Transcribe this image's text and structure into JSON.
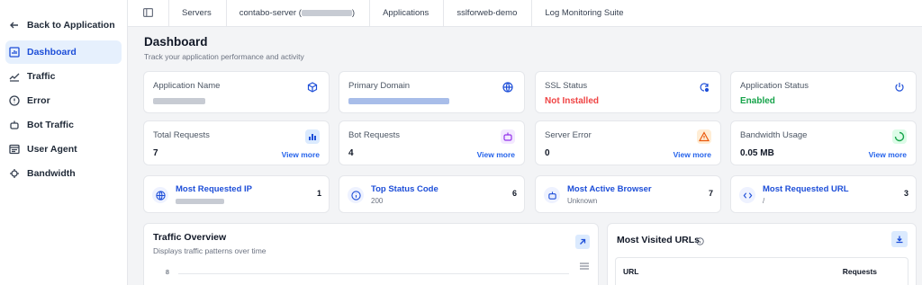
{
  "sidebar": {
    "back_label": "Back to Application",
    "items": [
      {
        "label": "Dashboard",
        "icon": "bar-chart-icon",
        "active": true
      },
      {
        "label": "Traffic",
        "icon": "trend-icon",
        "active": false
      },
      {
        "label": "Error",
        "icon": "alert-circle-icon",
        "active": false
      },
      {
        "label": "Bot Traffic",
        "icon": "robot-icon",
        "active": false
      },
      {
        "label": "User Agent",
        "icon": "browser-icon",
        "active": false
      },
      {
        "label": "Bandwidth",
        "icon": "network-icon",
        "active": false
      }
    ]
  },
  "breadcrumb": {
    "servers": "Servers",
    "server_prefix": "contabo-server (",
    "server_suffix": ")",
    "applications": "Applications",
    "app": "sslforweb-demo",
    "suite": "Log Monitoring Suite"
  },
  "header": {
    "title": "Dashboard",
    "subtitle": "Track your application performance and activity"
  },
  "info_cards": [
    {
      "label": "Application Name",
      "value": "",
      "icon": "cube-icon"
    },
    {
      "label": "Primary Domain",
      "value": "",
      "icon": "globe-icon"
    },
    {
      "label": "SSL Status",
      "value": "Not Installed",
      "icon": "refresh-shield-icon"
    },
    {
      "label": "Application Status",
      "value": "Enabled",
      "icon": "power-icon"
    }
  ],
  "stat_cards": [
    {
      "label": "Total Requests",
      "value": "7",
      "link": "View more",
      "icon": "bar-chart-icon"
    },
    {
      "label": "Bot Requests",
      "value": "4",
      "link": "View more",
      "icon": "bot-icon"
    },
    {
      "label": "Server Error",
      "value": "0",
      "link": "View more",
      "icon": "warning-icon"
    },
    {
      "label": "Bandwidth Usage",
      "value": "0.05 MB",
      "link": "View more",
      "icon": "spinner-icon"
    }
  ],
  "mini_cards": [
    {
      "title": "Most Requested IP",
      "sub": "",
      "count": "1",
      "icon": "globe-icon"
    },
    {
      "title": "Top Status Code",
      "sub": "200",
      "count": "6",
      "icon": "info-icon"
    },
    {
      "title": "Most Active Browser",
      "sub": "Unknown",
      "count": "7",
      "icon": "robot-icon"
    },
    {
      "title": "Most Requested URL",
      "sub": "/",
      "count": "3",
      "icon": "code-icon"
    }
  ],
  "traffic": {
    "title": "Traffic Overview",
    "subtitle": "Displays traffic patterns over time",
    "y_tick": "8"
  },
  "urls": {
    "title": "Most Visited URLs",
    "col_url": "URL",
    "col_requests": "Requests"
  }
}
